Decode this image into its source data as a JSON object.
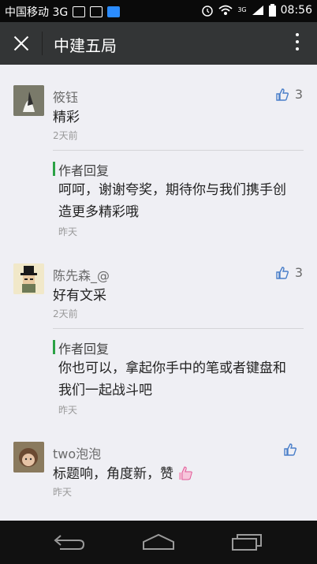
{
  "status_bar": {
    "carrier": "中国移动 3G",
    "network_label": "3G",
    "time": "08:56"
  },
  "header": {
    "title": "中建五局"
  },
  "comments": [
    {
      "name": "筱钰",
      "text": "精彩",
      "time": "2天前",
      "likes": "3",
      "reply": {
        "label": "作者回复",
        "text": "呵呵，谢谢夸奖，期待你与我们携手创造更多精彩哦",
        "time": "昨天"
      }
    },
    {
      "name": "陈先森_@",
      "text": "好有文采",
      "time": "2天前",
      "likes": "3",
      "reply": {
        "label": "作者回复",
        "text": "你也可以，拿起你手中的笔或者键盘和我们一起战斗吧",
        "time": "昨天"
      }
    },
    {
      "name": "two泡泡",
      "text": "标题响，角度新，赞",
      "time": "昨天",
      "likes": ""
    }
  ],
  "colors": {
    "reply_accent": "#2ba245",
    "title_bar": "#333536",
    "like_icon": "#4a7fc9"
  },
  "icons": {
    "close": "close-icon",
    "more": "more-vertical-icon",
    "like": "thumbs-up-icon",
    "back": "back-icon",
    "home": "home-icon",
    "recent": "recent-apps-icon"
  }
}
